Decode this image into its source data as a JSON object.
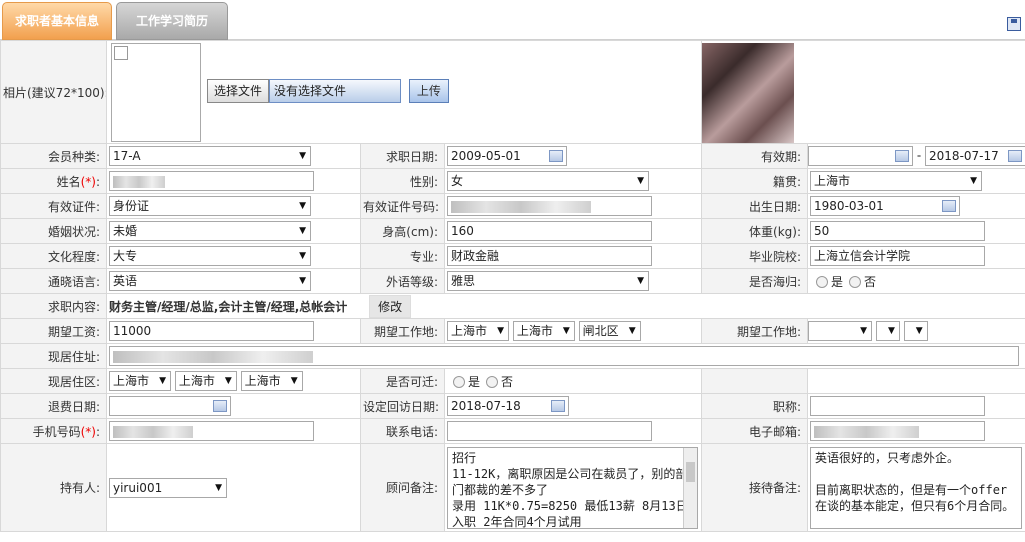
{
  "tabs": [
    "求职者基本信息",
    "工作学习简历"
  ],
  "photo": {
    "label": "相片(建议72*100):",
    "choose_btn": "选择文件",
    "no_file": "没有选择文件",
    "upload_btn": "上传"
  },
  "fields": {
    "member_type": {
      "label": "会员种类:",
      "value": "17-A"
    },
    "job_date": {
      "label": "求职日期:",
      "value": "2009-05-01"
    },
    "valid_period": {
      "label": "有效期:",
      "start": "",
      "sep": "-",
      "end": "2018-07-17"
    },
    "name": {
      "label": "姓名",
      "req": "(*)",
      "colon": ":"
    },
    "gender": {
      "label": "性别:",
      "value": "女"
    },
    "native": {
      "label": "籍贯:",
      "value": "上海市"
    },
    "id_type": {
      "label": "有效证件:",
      "value": "身份证"
    },
    "id_no": {
      "label": "有效证件号码:"
    },
    "birth": {
      "label": "出生日期:",
      "value": "1980-03-01"
    },
    "marital": {
      "label": "婚姻状况:",
      "value": "未婚"
    },
    "height": {
      "label": "身高(cm):",
      "value": "160"
    },
    "weight": {
      "label": "体重(kg):",
      "value": "50"
    },
    "education": {
      "label": "文化程度:",
      "value": "大专"
    },
    "major": {
      "label": "专业:",
      "value": "财政金融"
    },
    "school": {
      "label": "毕业院校:",
      "value": "上海立信会计学院"
    },
    "language": {
      "label": "通晓语言:",
      "value": "英语"
    },
    "lang_level": {
      "label": "外语等级:",
      "value": "雅思"
    },
    "overseas": {
      "label": "是否海归:",
      "yes": "是",
      "no": "否"
    },
    "job_content": {
      "label": "求职内容:",
      "value": "财务主管/经理/总监,会计主管/经理,总帐会计",
      "btn": "修改"
    },
    "salary": {
      "label": "期望工资:",
      "value": "11000"
    },
    "work_place1": {
      "label": "期望工作地:",
      "p1": "上海市",
      "p2": "上海市",
      "p3": "闸北区"
    },
    "work_place2": {
      "label": "期望工作地:"
    },
    "address": {
      "label": "现居住址:"
    },
    "live_area": {
      "label": "现居住区:",
      "p1": "上海市",
      "p2": "上海市",
      "p3": "上海市"
    },
    "relocate": {
      "label": "是否可迁:",
      "yes": "是",
      "no": "否"
    },
    "refund_date": {
      "label": "退费日期:"
    },
    "callback_date": {
      "label": "设定回访日期:",
      "value": "2018-07-18"
    },
    "title": {
      "label": "职称:"
    },
    "mobile": {
      "label": "手机号码",
      "req": "(*)",
      "colon": ":"
    },
    "phone": {
      "label": "联系电话:"
    },
    "email": {
      "label": "电子邮箱:"
    },
    "holder": {
      "label": "持有人:",
      "value": "yirui001"
    },
    "advisor_note": {
      "label": "顾问备注:",
      "lines": [
        "招行",
        "11-12K，离职原因是公司在裁员了，别的部门都裁的差不多了",
        "录用  11K*0.75=8250 最低13薪 8月13日入职 2年合同4个月试用"
      ]
    },
    "reception_note": {
      "label": "接待备注:",
      "lines": [
        "英语很好的，只考虑外企。",
        "",
        "目前离职状态的，但是有一个offer在谈的基本能定，但只有6个月合同。"
      ]
    }
  }
}
